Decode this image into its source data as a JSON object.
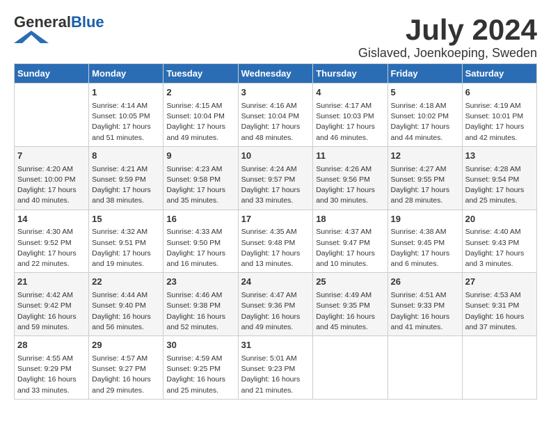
{
  "header": {
    "logo_general": "General",
    "logo_blue": "Blue",
    "month_title": "July 2024",
    "location": "Gislaved, Joenkoeping, Sweden"
  },
  "days_of_week": [
    "Sunday",
    "Monday",
    "Tuesday",
    "Wednesday",
    "Thursday",
    "Friday",
    "Saturday"
  ],
  "weeks": [
    [
      {
        "day": "",
        "sunrise": "",
        "sunset": "",
        "daylight": ""
      },
      {
        "day": "1",
        "sunrise": "Sunrise: 4:14 AM",
        "sunset": "Sunset: 10:05 PM",
        "daylight": "Daylight: 17 hours and 51 minutes."
      },
      {
        "day": "2",
        "sunrise": "Sunrise: 4:15 AM",
        "sunset": "Sunset: 10:04 PM",
        "daylight": "Daylight: 17 hours and 49 minutes."
      },
      {
        "day": "3",
        "sunrise": "Sunrise: 4:16 AM",
        "sunset": "Sunset: 10:04 PM",
        "daylight": "Daylight: 17 hours and 48 minutes."
      },
      {
        "day": "4",
        "sunrise": "Sunrise: 4:17 AM",
        "sunset": "Sunset: 10:03 PM",
        "daylight": "Daylight: 17 hours and 46 minutes."
      },
      {
        "day": "5",
        "sunrise": "Sunrise: 4:18 AM",
        "sunset": "Sunset: 10:02 PM",
        "daylight": "Daylight: 17 hours and 44 minutes."
      },
      {
        "day": "6",
        "sunrise": "Sunrise: 4:19 AM",
        "sunset": "Sunset: 10:01 PM",
        "daylight": "Daylight: 17 hours and 42 minutes."
      }
    ],
    [
      {
        "day": "7",
        "sunrise": "Sunrise: 4:20 AM",
        "sunset": "Sunset: 10:00 PM",
        "daylight": "Daylight: 17 hours and 40 minutes."
      },
      {
        "day": "8",
        "sunrise": "Sunrise: 4:21 AM",
        "sunset": "Sunset: 9:59 PM",
        "daylight": "Daylight: 17 hours and 38 minutes."
      },
      {
        "day": "9",
        "sunrise": "Sunrise: 4:23 AM",
        "sunset": "Sunset: 9:58 PM",
        "daylight": "Daylight: 17 hours and 35 minutes."
      },
      {
        "day": "10",
        "sunrise": "Sunrise: 4:24 AM",
        "sunset": "Sunset: 9:57 PM",
        "daylight": "Daylight: 17 hours and 33 minutes."
      },
      {
        "day": "11",
        "sunrise": "Sunrise: 4:26 AM",
        "sunset": "Sunset: 9:56 PM",
        "daylight": "Daylight: 17 hours and 30 minutes."
      },
      {
        "day": "12",
        "sunrise": "Sunrise: 4:27 AM",
        "sunset": "Sunset: 9:55 PM",
        "daylight": "Daylight: 17 hours and 28 minutes."
      },
      {
        "day": "13",
        "sunrise": "Sunrise: 4:28 AM",
        "sunset": "Sunset: 9:54 PM",
        "daylight": "Daylight: 17 hours and 25 minutes."
      }
    ],
    [
      {
        "day": "14",
        "sunrise": "Sunrise: 4:30 AM",
        "sunset": "Sunset: 9:52 PM",
        "daylight": "Daylight: 17 hours and 22 minutes."
      },
      {
        "day": "15",
        "sunrise": "Sunrise: 4:32 AM",
        "sunset": "Sunset: 9:51 PM",
        "daylight": "Daylight: 17 hours and 19 minutes."
      },
      {
        "day": "16",
        "sunrise": "Sunrise: 4:33 AM",
        "sunset": "Sunset: 9:50 PM",
        "daylight": "Daylight: 17 hours and 16 minutes."
      },
      {
        "day": "17",
        "sunrise": "Sunrise: 4:35 AM",
        "sunset": "Sunset: 9:48 PM",
        "daylight": "Daylight: 17 hours and 13 minutes."
      },
      {
        "day": "18",
        "sunrise": "Sunrise: 4:37 AM",
        "sunset": "Sunset: 9:47 PM",
        "daylight": "Daylight: 17 hours and 10 minutes."
      },
      {
        "day": "19",
        "sunrise": "Sunrise: 4:38 AM",
        "sunset": "Sunset: 9:45 PM",
        "daylight": "Daylight: 17 hours and 6 minutes."
      },
      {
        "day": "20",
        "sunrise": "Sunrise: 4:40 AM",
        "sunset": "Sunset: 9:43 PM",
        "daylight": "Daylight: 17 hours and 3 minutes."
      }
    ],
    [
      {
        "day": "21",
        "sunrise": "Sunrise: 4:42 AM",
        "sunset": "Sunset: 9:42 PM",
        "daylight": "Daylight: 16 hours and 59 minutes."
      },
      {
        "day": "22",
        "sunrise": "Sunrise: 4:44 AM",
        "sunset": "Sunset: 9:40 PM",
        "daylight": "Daylight: 16 hours and 56 minutes."
      },
      {
        "day": "23",
        "sunrise": "Sunrise: 4:46 AM",
        "sunset": "Sunset: 9:38 PM",
        "daylight": "Daylight: 16 hours and 52 minutes."
      },
      {
        "day": "24",
        "sunrise": "Sunrise: 4:47 AM",
        "sunset": "Sunset: 9:36 PM",
        "daylight": "Daylight: 16 hours and 49 minutes."
      },
      {
        "day": "25",
        "sunrise": "Sunrise: 4:49 AM",
        "sunset": "Sunset: 9:35 PM",
        "daylight": "Daylight: 16 hours and 45 minutes."
      },
      {
        "day": "26",
        "sunrise": "Sunrise: 4:51 AM",
        "sunset": "Sunset: 9:33 PM",
        "daylight": "Daylight: 16 hours and 41 minutes."
      },
      {
        "day": "27",
        "sunrise": "Sunrise: 4:53 AM",
        "sunset": "Sunset: 9:31 PM",
        "daylight": "Daylight: 16 hours and 37 minutes."
      }
    ],
    [
      {
        "day": "28",
        "sunrise": "Sunrise: 4:55 AM",
        "sunset": "Sunset: 9:29 PM",
        "daylight": "Daylight: 16 hours and 33 minutes."
      },
      {
        "day": "29",
        "sunrise": "Sunrise: 4:57 AM",
        "sunset": "Sunset: 9:27 PM",
        "daylight": "Daylight: 16 hours and 29 minutes."
      },
      {
        "day": "30",
        "sunrise": "Sunrise: 4:59 AM",
        "sunset": "Sunset: 9:25 PM",
        "daylight": "Daylight: 16 hours and 25 minutes."
      },
      {
        "day": "31",
        "sunrise": "Sunrise: 5:01 AM",
        "sunset": "Sunset: 9:23 PM",
        "daylight": "Daylight: 16 hours and 21 minutes."
      },
      {
        "day": "",
        "sunrise": "",
        "sunset": "",
        "daylight": ""
      },
      {
        "day": "",
        "sunrise": "",
        "sunset": "",
        "daylight": ""
      },
      {
        "day": "",
        "sunrise": "",
        "sunset": "",
        "daylight": ""
      }
    ]
  ]
}
